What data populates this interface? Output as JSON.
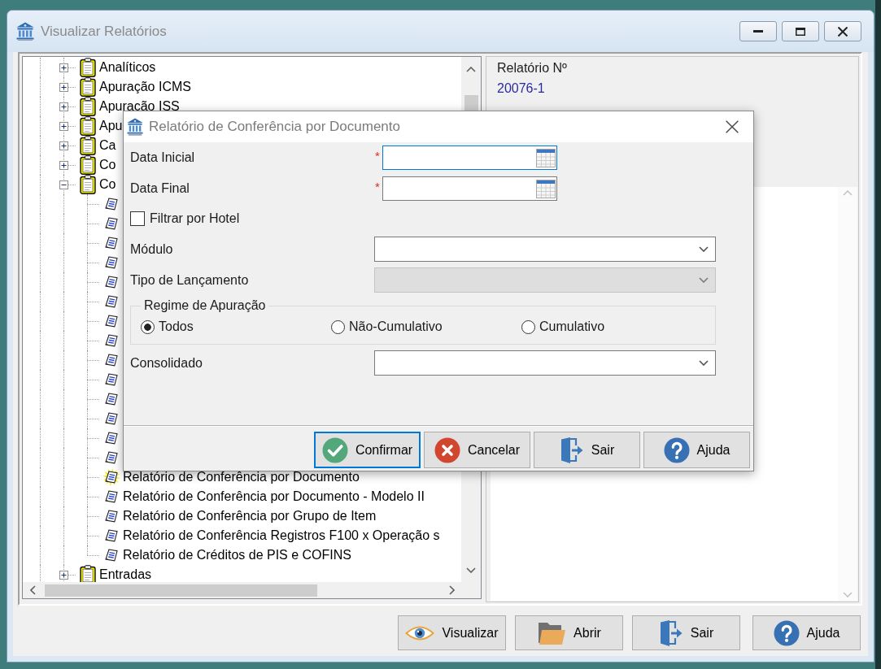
{
  "main_window": {
    "title": "Visualizar Relatórios",
    "report_tree": [
      {
        "kind": "folder",
        "label": "Analíticos",
        "expanded": false
      },
      {
        "kind": "folder",
        "label": "Apuração ICMS",
        "expanded": false
      },
      {
        "kind": "folder",
        "label": "Apuração ISS",
        "expanded": false
      },
      {
        "kind": "folder",
        "label": "Apu",
        "expanded": false
      },
      {
        "kind": "folder",
        "label": "Ca",
        "expanded": false
      },
      {
        "kind": "folder",
        "label": "Co",
        "expanded": false
      },
      {
        "kind": "folder",
        "label": "Co",
        "expanded": true,
        "children": [
          {
            "kind": "report",
            "selected": false
          },
          {
            "kind": "report",
            "selected": false
          },
          {
            "kind": "report",
            "selected": false
          },
          {
            "kind": "report",
            "selected": false
          },
          {
            "kind": "report",
            "selected": false
          },
          {
            "kind": "report",
            "selected": false
          },
          {
            "kind": "report",
            "selected": false
          },
          {
            "kind": "report",
            "selected": false
          },
          {
            "kind": "report",
            "selected": false
          },
          {
            "kind": "report",
            "selected": false
          },
          {
            "kind": "report",
            "selected": false
          },
          {
            "kind": "report",
            "selected": false
          },
          {
            "kind": "report",
            "selected": false
          },
          {
            "kind": "report",
            "selected": false
          },
          {
            "kind": "report",
            "label": "Relatório de Conferência por Documento",
            "selected": true
          },
          {
            "kind": "report",
            "label": "Relatório de Conferência por Documento - Modelo II",
            "selected": false
          },
          {
            "kind": "report",
            "label": "Relatório de Conferência por Grupo de Item",
            "selected": false
          },
          {
            "kind": "report",
            "label": "Relatório de Conferência Registros F100 x Operação s",
            "selected": false
          },
          {
            "kind": "report",
            "label": "Relatório de Créditos de PIS e COFINS",
            "selected": false
          }
        ]
      },
      {
        "kind": "folder",
        "label": "Entradas",
        "expanded": false
      }
    ],
    "details": {
      "label": "Relatório Nº",
      "value": "20076-1"
    },
    "buttons": [
      {
        "kind": "view",
        "label": "Visualizar"
      },
      {
        "kind": "open",
        "label": "Abrir"
      },
      {
        "kind": "exit",
        "label": "Sair"
      },
      {
        "kind": "help",
        "label": "Ajuda"
      }
    ]
  },
  "dialog": {
    "title": "Relatório de Conferência por Documento",
    "fields": [
      {
        "kind": "date",
        "label": "Data Inicial",
        "required_mark": "*",
        "focused": true,
        "disabled": false
      },
      {
        "kind": "date",
        "label": "Data Final",
        "required_mark": "*",
        "focused": false,
        "disabled": false
      },
      {
        "kind": "checkbox",
        "label": "Filtrar por Hotel",
        "checked": false
      },
      {
        "kind": "select",
        "label": "Módulo",
        "focused": false,
        "disabled": false
      },
      {
        "kind": "select",
        "label": "Tipo de Lançamento",
        "focused": false,
        "disabled": true
      },
      {
        "kind": "radio_group",
        "label": "Regime de Apuração",
        "options": [
          {
            "label": "Todos",
            "selected": true
          },
          {
            "label": "Não-Cumulativo",
            "selected": false
          },
          {
            "label": "Cumulativo",
            "selected": false
          }
        ]
      },
      {
        "kind": "select",
        "label": "Consolidado",
        "focused": false,
        "disabled": false
      }
    ],
    "buttons": [
      {
        "kind": "confirm",
        "label": "Confirmar",
        "focused": true
      },
      {
        "kind": "cancel",
        "label": "Cancelar",
        "focused": false
      },
      {
        "kind": "exit",
        "label": "Sair",
        "focused": false
      },
      {
        "kind": "help",
        "label": "Ajuda",
        "focused": false
      }
    ]
  }
}
